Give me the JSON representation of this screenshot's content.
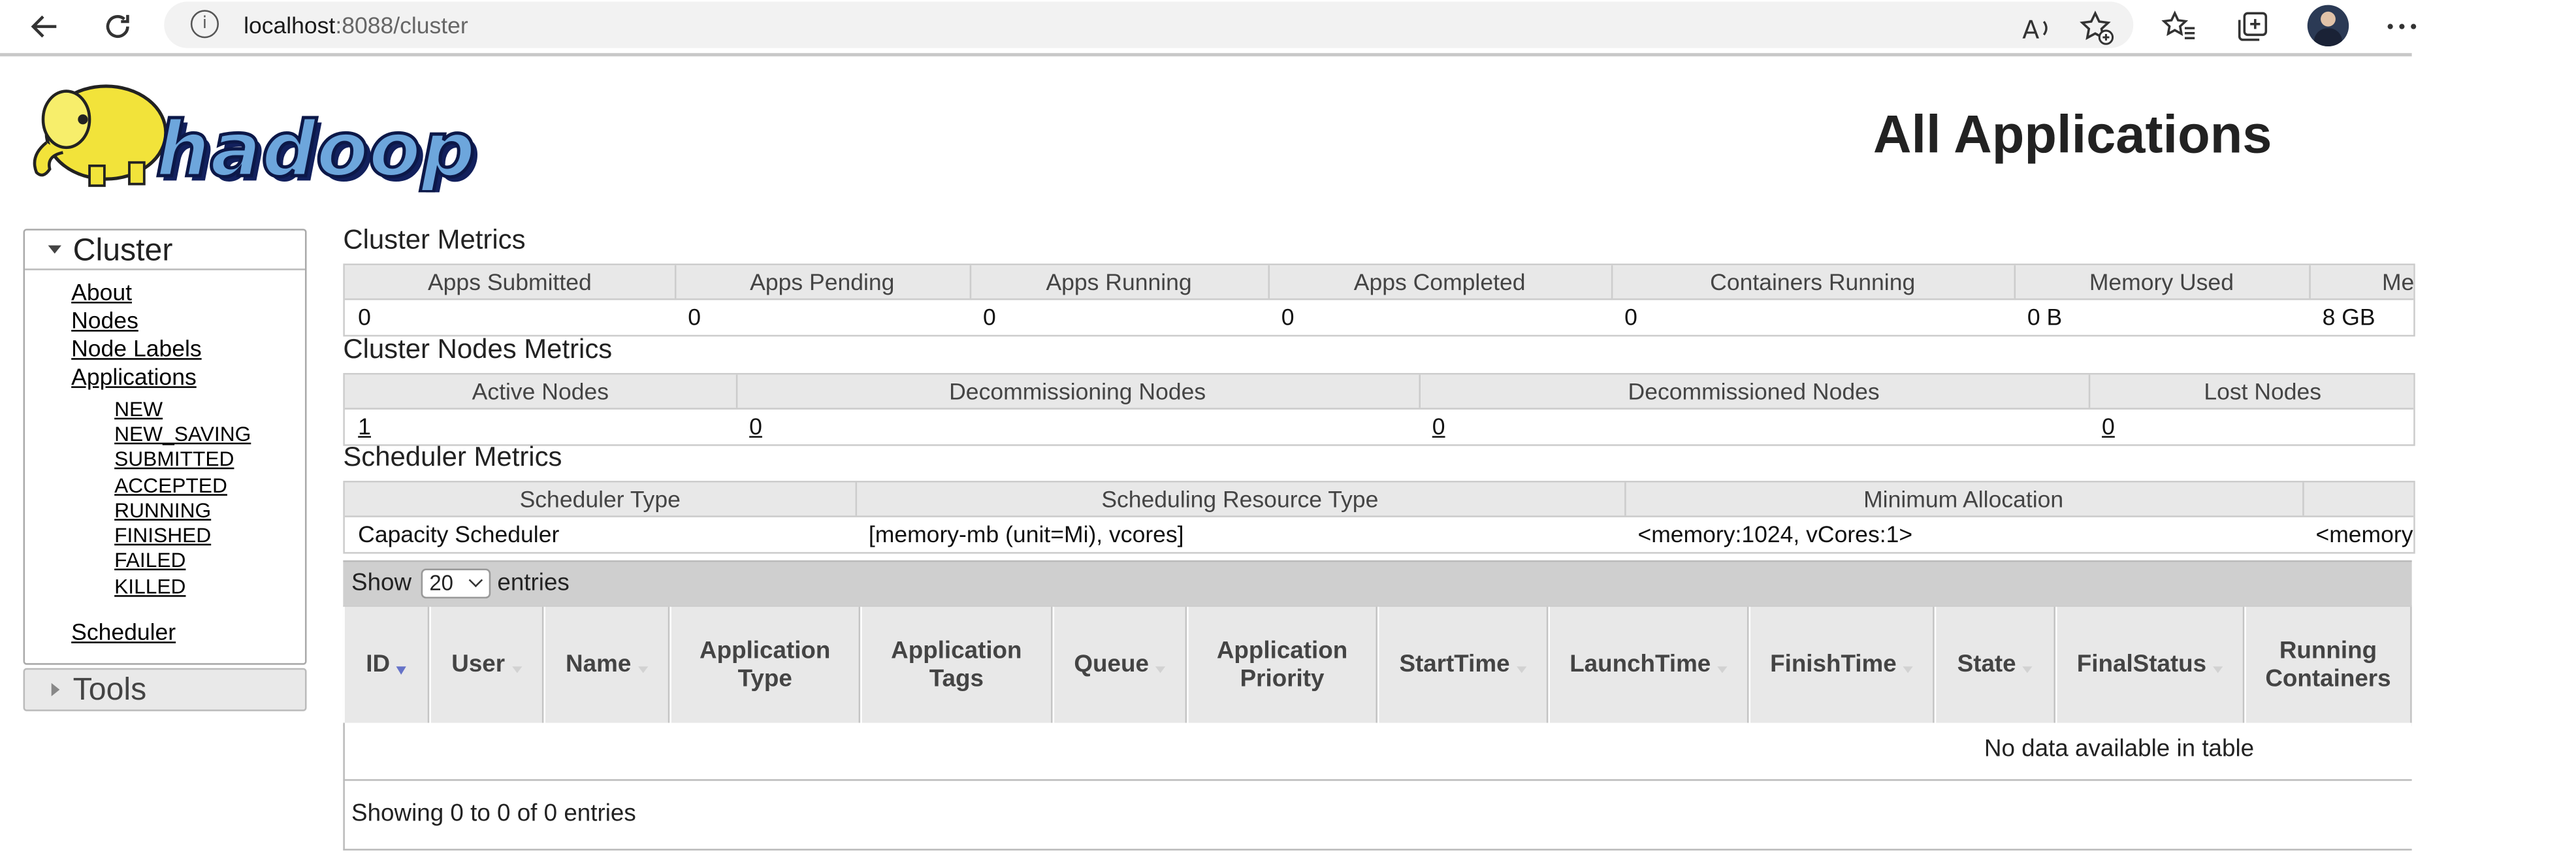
{
  "browser": {
    "url_host": "localhost",
    "url_rest": ":8088/cluster",
    "icons": [
      "back-arrow-icon",
      "refresh-icon",
      "info-icon",
      "read-aloud-icon",
      "favorite-add-icon",
      "favorites-icon",
      "collections-icon",
      "profile-avatar",
      "more-icon"
    ]
  },
  "header": {
    "logo_text": "hadoop",
    "title": "All Applications"
  },
  "sidebar": {
    "cluster_label": "Cluster",
    "links": [
      "About",
      "Nodes",
      "Node Labels",
      "Applications"
    ],
    "app_states": [
      "NEW",
      "NEW_SAVING",
      "SUBMITTED",
      "ACCEPTED",
      "RUNNING",
      "FINISHED",
      "FAILED",
      "KILLED"
    ],
    "scheduler_label": "Scheduler",
    "tools_label": "Tools"
  },
  "cluster_metrics": {
    "title": "Cluster Metrics",
    "headers": [
      "Apps Submitted",
      "Apps Pending",
      "Apps Running",
      "Apps Completed",
      "Containers Running",
      "Memory Used",
      "Me"
    ],
    "values": [
      "0",
      "0",
      "0",
      "0",
      "0",
      "0 B",
      "8 GB"
    ]
  },
  "nodes_metrics": {
    "title": "Cluster Nodes Metrics",
    "headers": [
      "Active Nodes",
      "Decommissioning Nodes",
      "Decommissioned Nodes",
      "Lost Nodes"
    ],
    "values": [
      "1",
      "0",
      "0",
      "0"
    ]
  },
  "scheduler_metrics": {
    "title": "Scheduler Metrics",
    "headers": [
      "Scheduler Type",
      "Scheduling Resource Type",
      "Minimum Allocation",
      ""
    ],
    "values": [
      "Capacity Scheduler",
      "[memory-mb (unit=Mi), vcores]",
      "<memory:1024, vCores:1>",
      "<memory"
    ]
  },
  "apps_table": {
    "show_label": "Show",
    "entries_label": "entries",
    "page_size": "20",
    "columns": [
      "ID",
      "User",
      "Name",
      "Application Type",
      "Application Tags",
      "Queue",
      "Application Priority",
      "StartTime",
      "LaunchTime",
      "FinishTime",
      "State",
      "FinalStatus",
      "Running Containers"
    ],
    "empty_message": "No data available in table",
    "info": "Showing 0 to 0 of 0 entries"
  }
}
